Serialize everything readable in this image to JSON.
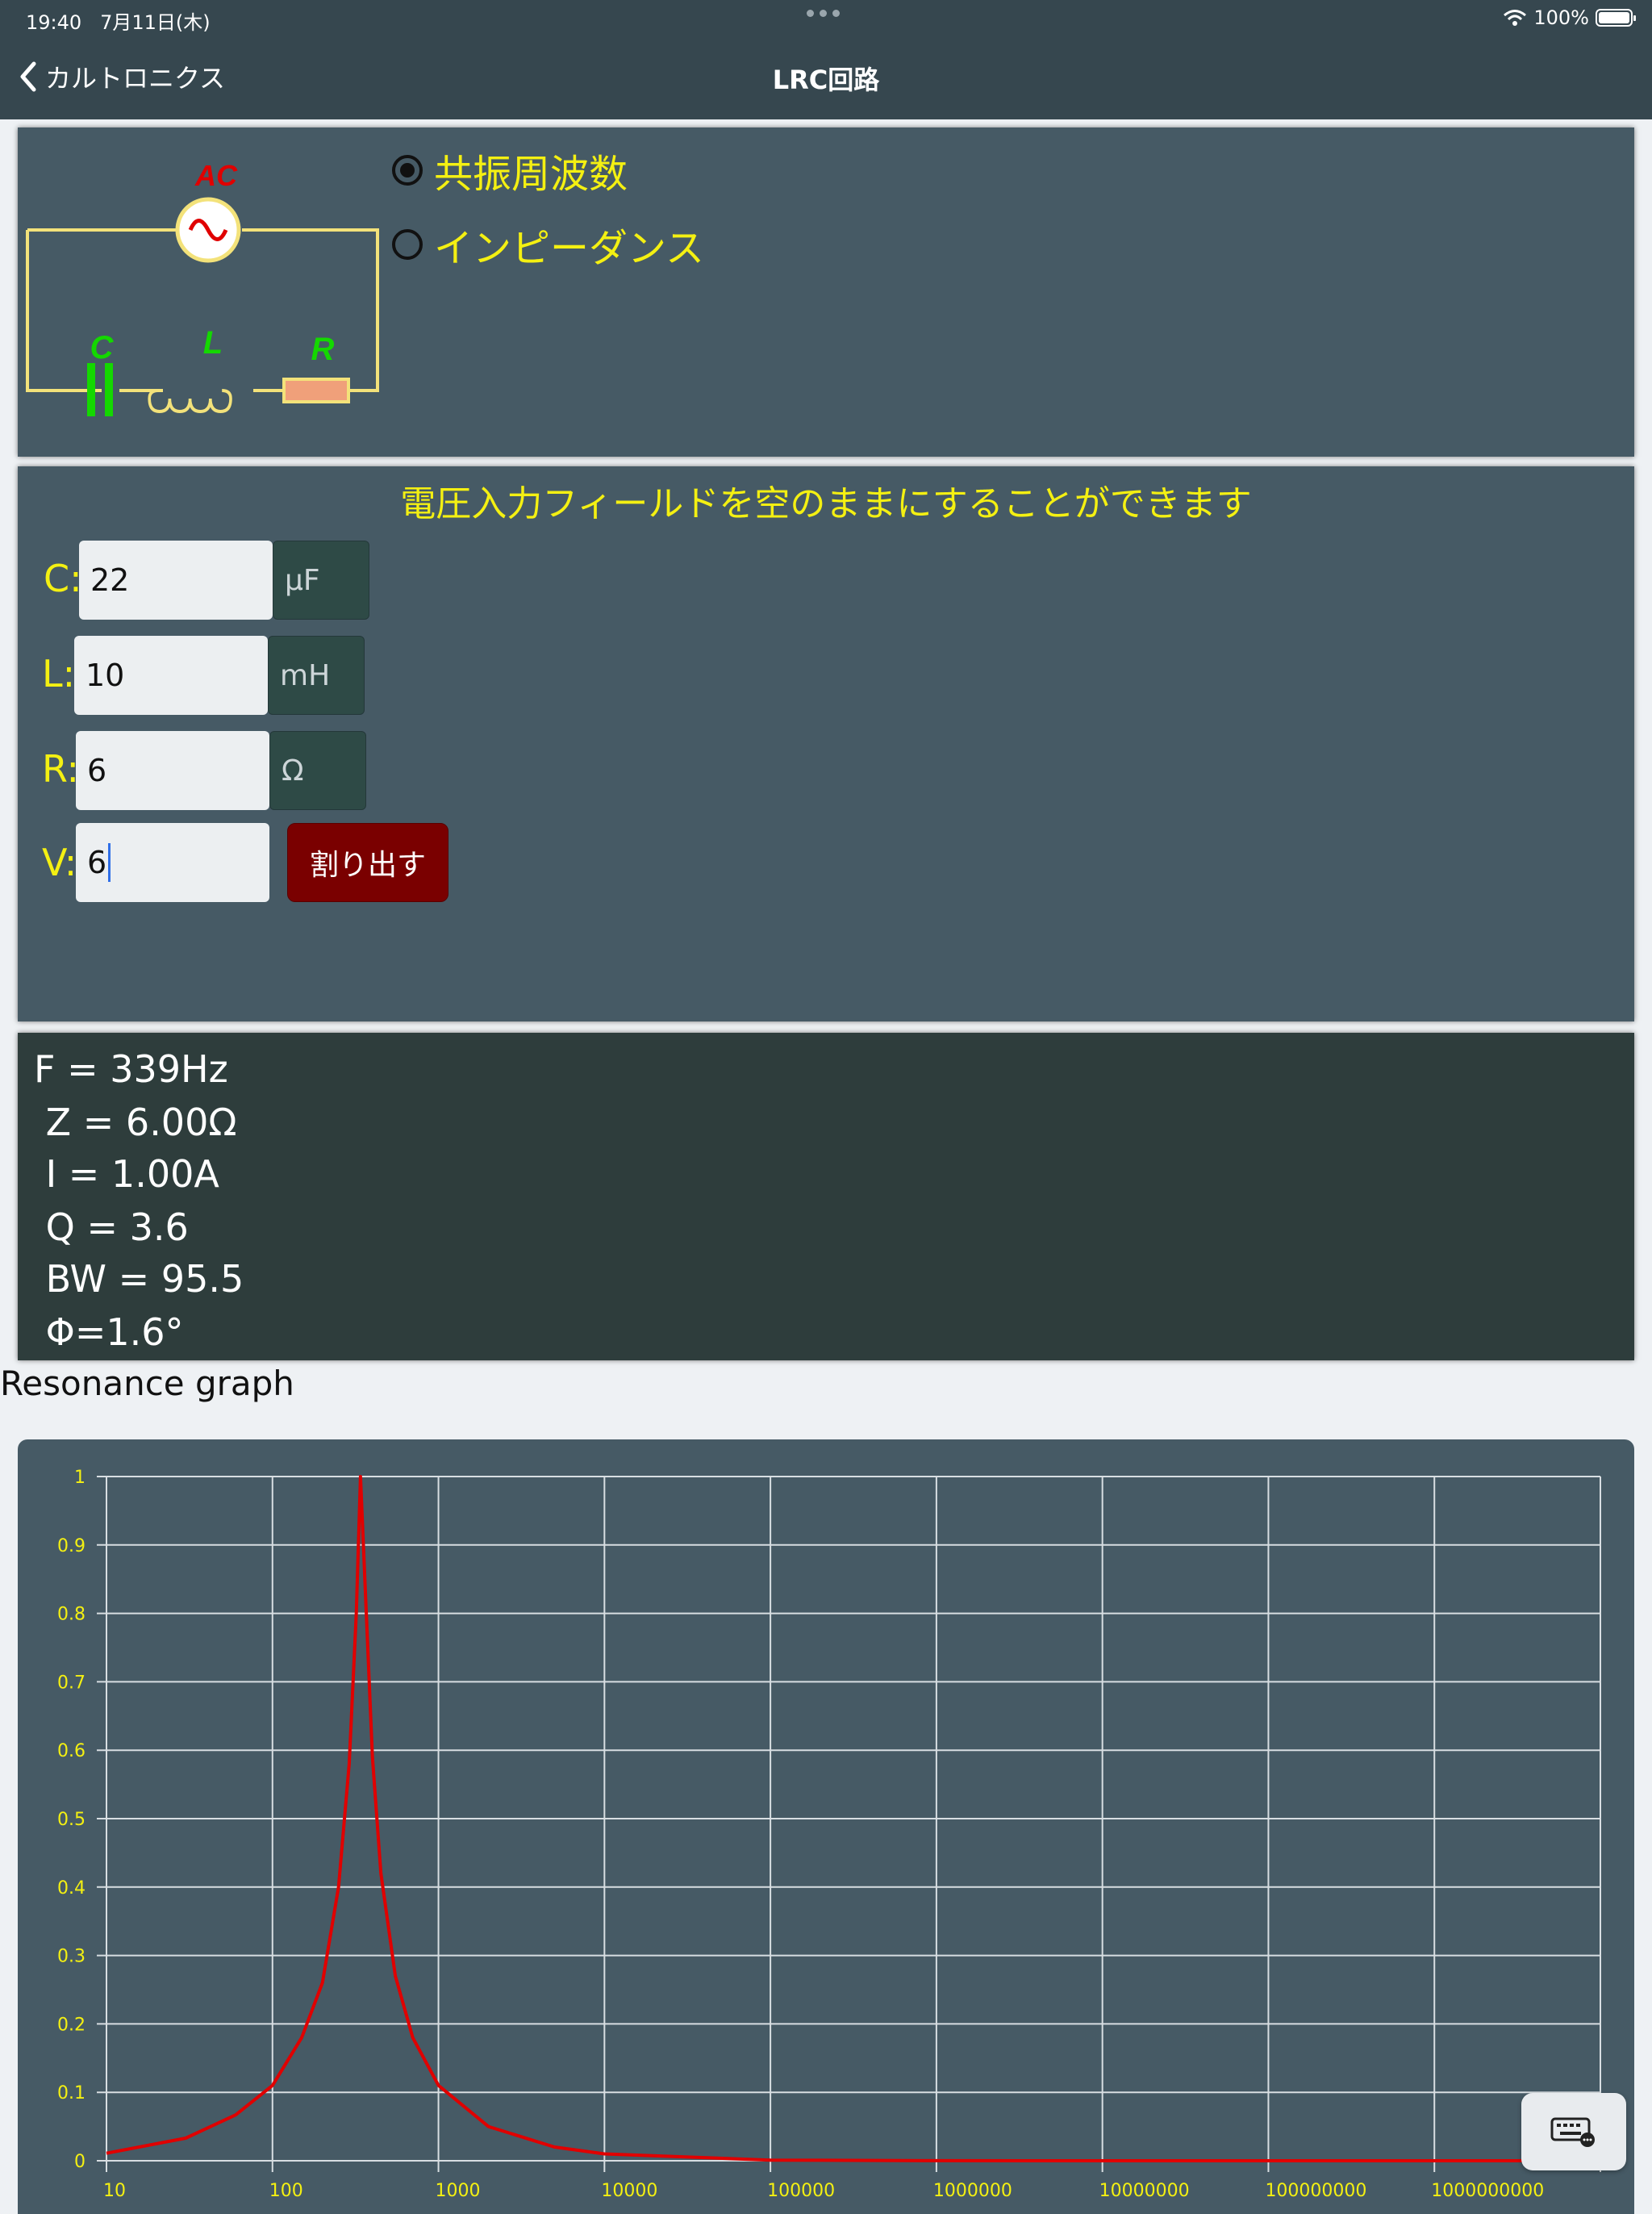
{
  "status_bar": {
    "time": "19:40",
    "date": "7月11日(木)",
    "battery": "100%"
  },
  "nav": {
    "back_label": "カルトロニクス",
    "title": "LRC回路"
  },
  "circuit": {
    "source_label": "AC",
    "capacitor_label": "C",
    "inductor_label": "L",
    "resistor_label": "R"
  },
  "mode": {
    "options": [
      {
        "label": "共振周波数",
        "selected": true
      },
      {
        "label": "インピーダンス",
        "selected": false
      }
    ]
  },
  "form": {
    "hint": "電圧入力フィールドを空のままにすることができます",
    "fields": [
      {
        "label": "C:",
        "value": "22",
        "unit": "μF"
      },
      {
        "label": "L:",
        "value": "10",
        "unit": "mH"
      },
      {
        "label": "R:",
        "value": "6",
        "unit": "Ω"
      },
      {
        "label": "V:",
        "value": "6"
      }
    ],
    "calculate_label": "割り出す"
  },
  "results": [
    "F = 339Hz",
    " Z = 6.00Ω",
    " I = 1.00A",
    " Q = 3.6",
    " BW = 95.5",
    " Φ=1.6°"
  ],
  "graph": {
    "title": "Resonance graph"
  },
  "colors": {
    "label_yellow": "#f4f012",
    "curve_red": "#e00000",
    "panel": "#465a65",
    "result_panel": "#2e3d3c",
    "button_red": "#7a0000"
  },
  "chart_data": {
    "type": "line",
    "x_scale": "log",
    "y_ticks": [
      "1",
      "0.9",
      "0.8",
      "0.7",
      "0.6",
      "0.5",
      "0.4",
      "0.3",
      "0.2",
      "0.1",
      "0"
    ],
    "x_ticks": [
      "10",
      "100",
      "1000",
      "10000",
      "100000",
      "1000000",
      "10000000",
      "100000000",
      "1000000000"
    ],
    "ylim": [
      0,
      1
    ],
    "xlim": [
      10,
      10000000000
    ],
    "grid": true,
    "series": [
      {
        "color": "#e00000",
        "x": [
          10,
          30,
          60,
          100,
          150,
          200,
          250,
          290,
          320,
          339,
          360,
          400,
          450,
          550,
          700,
          1000,
          2000,
          5000,
          10000,
          100000,
          1000000,
          10000000,
          100000000,
          1000000000,
          10000000000
        ],
        "y": [
          0.011,
          0.033,
          0.067,
          0.11,
          0.18,
          0.26,
          0.4,
          0.58,
          0.8,
          1.0,
          0.85,
          0.59,
          0.42,
          0.27,
          0.18,
          0.11,
          0.05,
          0.02,
          0.01,
          0.001,
          0.0001,
          0,
          0,
          0,
          0
        ]
      }
    ]
  }
}
